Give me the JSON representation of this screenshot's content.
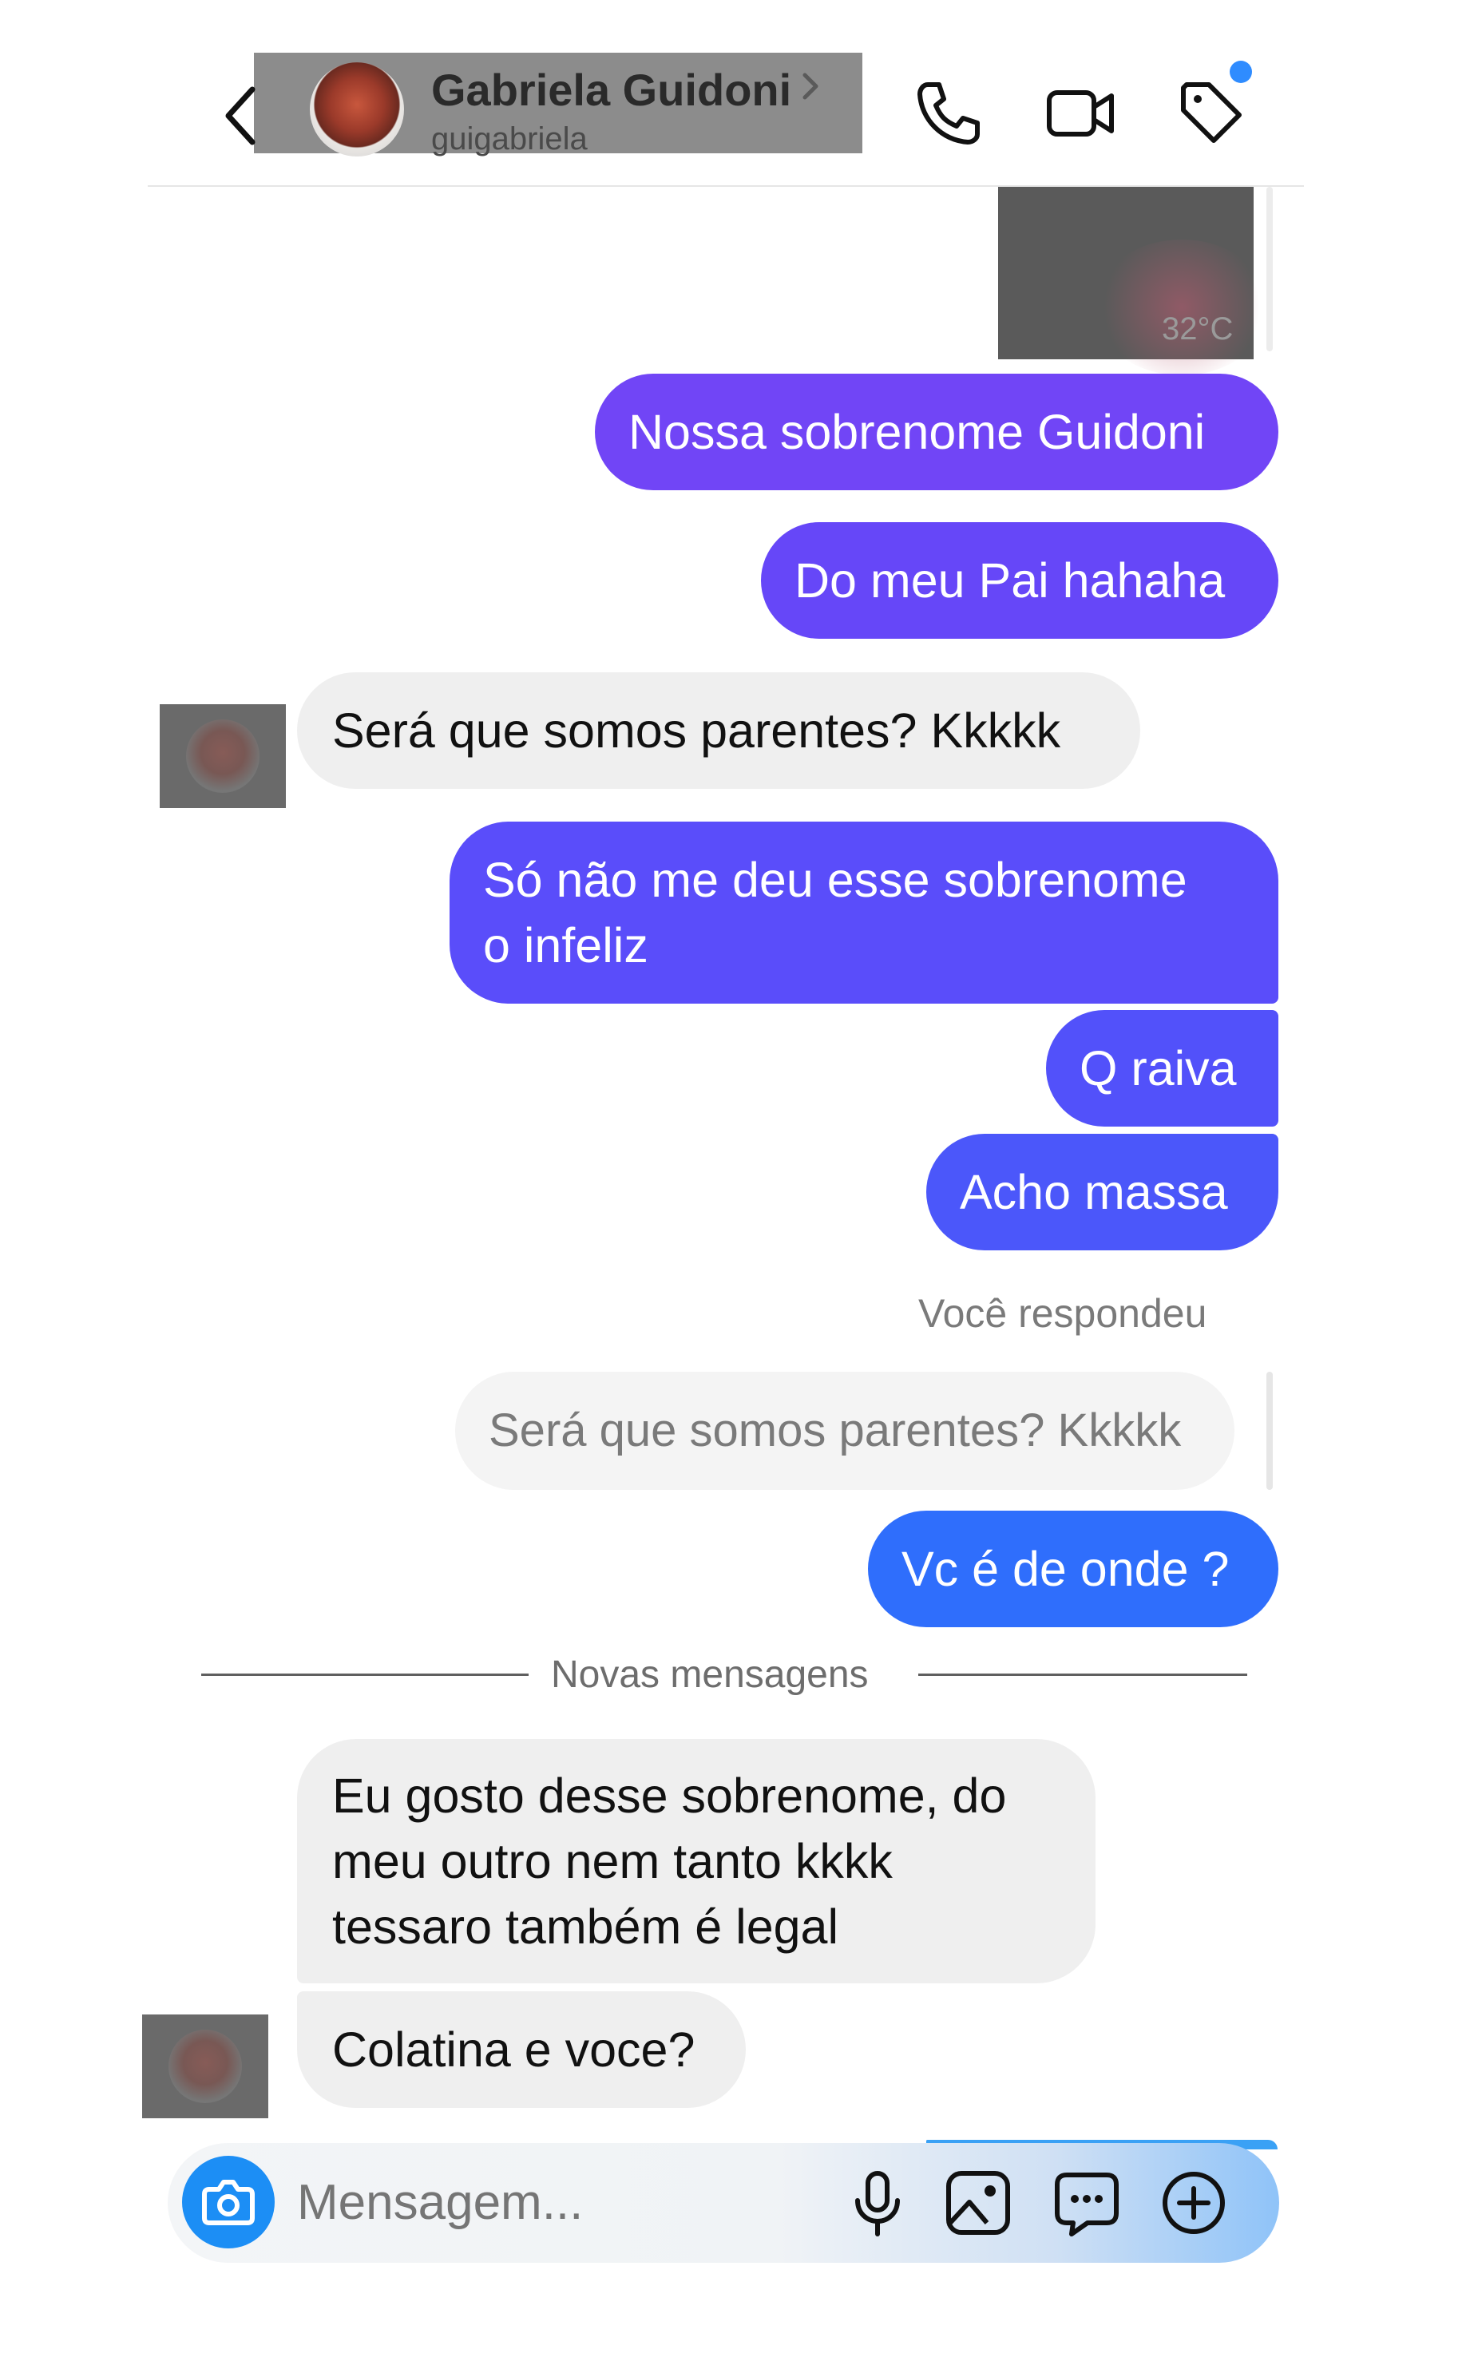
{
  "header": {
    "contact_name": "Gabriela Guidoni",
    "contact_username": "guigabriela"
  },
  "shared_photo": {
    "overlay_text": "32°C"
  },
  "messages": [
    {
      "direction": "outgoing",
      "text": "Nossa sobrenome Guidoni",
      "color": "#7145f6"
    },
    {
      "direction": "outgoing",
      "text": "Do meu Pai hahaha",
      "color": "#6647f8"
    },
    {
      "direction": "incoming",
      "text": "Será que somos parentes? Kkkkk"
    },
    {
      "direction": "outgoing",
      "lines": [
        "Só não me deu esse sobrenome",
        "o infeliz"
      ],
      "color": "#5a4dfa"
    },
    {
      "direction": "outgoing",
      "text": "Q raiva",
      "color": "#5251fa"
    },
    {
      "direction": "outgoing",
      "text": "Acho massa",
      "color": "#4b57fa"
    }
  ],
  "reply": {
    "label": "Você respondeu",
    "quoted_text": "Será que somos parentes? Kkkkk",
    "message": "Vc é de onde ?",
    "color": "#2f6efc"
  },
  "divider": {
    "label": "Novas mensagens"
  },
  "new_messages": [
    {
      "direction": "incoming",
      "lines": [
        "Eu gosto desse sobrenome, do",
        "meu outro nem tanto kkkk",
        "tessaro também é legal"
      ]
    },
    {
      "direction": "incoming",
      "text": "Colatina e voce?"
    }
  ],
  "composer": {
    "placeholder": "Mensagem...",
    "accent_color": "#1c8ef5"
  }
}
